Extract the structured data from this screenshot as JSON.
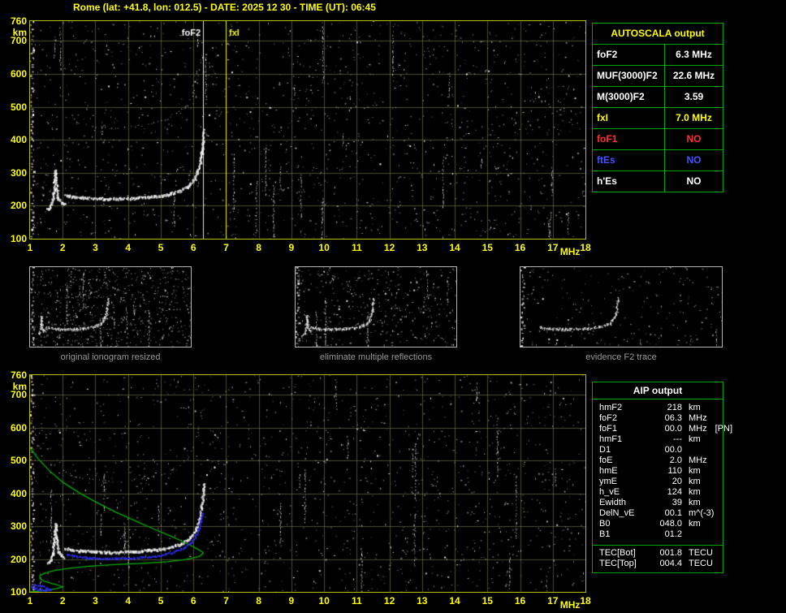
{
  "header": {
    "title": "Rome (lat: +41.8, lon: 012.5) - DATE: 2025 12 30 - TIME (UT): 06:45"
  },
  "autoscala_table": {
    "title": "AUTOSCALA output",
    "rows": [
      {
        "label": "foF2",
        "value": "6.3 MHz",
        "color": "#ffffff"
      },
      {
        "label": "MUF(3000)F2",
        "value": "22.6 MHz",
        "color": "#ffffff"
      },
      {
        "label": "M(3000)F2",
        "value": "3.59",
        "color": "#ffffff"
      },
      {
        "label": "fxI",
        "value": "7.0 MHz",
        "color": "#ffff00"
      },
      {
        "label": "foF1",
        "value": "NO",
        "color": "#ff3030"
      },
      {
        "label": "ftEs",
        "value": "NO",
        "color": "#4455ff"
      },
      {
        "label": "h'Es",
        "value": "NO",
        "color": "#ffffff"
      }
    ]
  },
  "aip_table": {
    "title": "AIP output",
    "rows": [
      {
        "label": "hmF2",
        "value": "218",
        "unit": "km",
        "extra": ""
      },
      {
        "label": "foF2",
        "value": "06.3",
        "unit": "MHz",
        "extra": ""
      },
      {
        "label": "foF1",
        "value": "00.0",
        "unit": "MHz",
        "extra": "[PN]"
      },
      {
        "label": "hmF1",
        "value": "---",
        "unit": "km",
        "extra": ""
      },
      {
        "label": "D1",
        "value": "00.0",
        "unit": "",
        "extra": ""
      },
      {
        "label": "foE",
        "value": "2.0",
        "unit": "MHz",
        "extra": ""
      },
      {
        "label": "hmE",
        "value": "110",
        "unit": "km",
        "extra": ""
      },
      {
        "label": "ymE",
        "value": "20",
        "unit": "km",
        "extra": ""
      },
      {
        "label": "h_vE",
        "value": "124",
        "unit": "km",
        "extra": ""
      },
      {
        "label": "Ewidth",
        "value": "39",
        "unit": "km",
        "extra": ""
      },
      {
        "label": "DelN_vE",
        "value": "00.1",
        "unit": "m^(-3)",
        "extra": ""
      },
      {
        "label": "B0",
        "value": "048.0",
        "unit": "km",
        "extra": ""
      },
      {
        "label": "B1",
        "value": "01.2",
        "unit": "",
        "extra": ""
      }
    ],
    "tec_rows": [
      {
        "label": "TEC[Bot]",
        "value": "001.8",
        "unit": "TECU"
      },
      {
        "label": "TEC[Top]",
        "value": "004.4",
        "unit": "TECU"
      }
    ]
  },
  "thumbnails": [
    {
      "caption": "original ionogram resized"
    },
    {
      "caption": "eliminate multiple reflections"
    },
    {
      "caption": "evidence F2 trace"
    }
  ],
  "colors": {
    "accent_yellow": "#ffff00",
    "table_green": "#00a800",
    "grid_olive": "rgba(150,150,95,0.5)",
    "trace_white": "#ffffff",
    "profile_green": "#00b000",
    "restored_blue": "#2b2bee",
    "caption_gray": "#9a9a9a",
    "foF1_red": "#ff3030",
    "ftEs_blue": "#4455ff"
  },
  "chart_data": [
    {
      "id": "ionogram-autoscala",
      "type": "scatter",
      "title": "ionogram with AUTOSCALA markers",
      "xlabel": "MHz",
      "ylabel": "km",
      "xlim": [
        1,
        18
      ],
      "ylim": [
        100,
        760
      ],
      "x_ticks": [
        1,
        2,
        3,
        4,
        5,
        6,
        7,
        8,
        9,
        10,
        11,
        12,
        13,
        14,
        15,
        16,
        17,
        18
      ],
      "y_ticks": [
        760,
        700,
        600,
        500,
        400,
        300,
        200,
        100
      ],
      "grid": true,
      "series": [
        {
          "name": "es-cusp",
          "render": "dots",
          "size": 2,
          "bold": true,
          "points": [
            [
              1.52,
              192
            ],
            [
              1.62,
              200
            ],
            [
              1.68,
              220
            ],
            [
              1.72,
              252
            ],
            [
              1.76,
              310
            ],
            [
              1.8,
              258
            ],
            [
              1.85,
              226
            ],
            [
              1.95,
              212
            ],
            [
              2.05,
              206
            ]
          ]
        },
        {
          "name": "f2-trace",
          "render": "dots",
          "size": 2,
          "bold": true,
          "points": [
            [
              2.05,
              236
            ],
            [
              2.3,
              230
            ],
            [
              2.6,
              227
            ],
            [
              3.0,
              225
            ],
            [
              3.4,
              224
            ],
            [
              3.8,
              224
            ],
            [
              4.2,
              226
            ],
            [
              4.6,
              229
            ],
            [
              5.0,
              233
            ],
            [
              5.3,
              239
            ],
            [
              5.6,
              249
            ],
            [
              5.85,
              263
            ],
            [
              6.0,
              281
            ],
            [
              6.1,
              302
            ],
            [
              6.18,
              328
            ],
            [
              6.24,
              362
            ],
            [
              6.28,
              400
            ],
            [
              6.3,
              432
            ]
          ]
        },
        {
          "name": "f2-second-hop",
          "render": "dots",
          "size": 1,
          "sparse": true,
          "points": [
            [
              2.0,
              470
            ],
            [
              2.4,
              452
            ],
            [
              2.9,
              442
            ],
            [
              3.4,
              437
            ],
            [
              3.9,
              438
            ],
            [
              4.4,
              444
            ],
            [
              4.8,
              452
            ],
            [
              5.2,
              464
            ],
            [
              5.5,
              480
            ],
            [
              5.8,
              505
            ],
            [
              6.0,
              540
            ],
            [
              6.1,
              575
            ],
            [
              6.18,
              615
            ],
            [
              6.24,
              655
            ]
          ]
        }
      ],
      "markers": [
        {
          "name": "foF2",
          "freq": 6.3,
          "color": "#ffffff",
          "label": "foF2",
          "label_side": "left"
        },
        {
          "name": "fxI",
          "freq": 7.0,
          "color": "#ffff00",
          "label": "fxI",
          "label_side": "right"
        }
      ]
    },
    {
      "id": "ionogram-aip",
      "type": "scatter",
      "title": "ionogram with AIP profile and restored trace",
      "xlabel": "MHz",
      "ylabel": "km",
      "xlim": [
        1,
        18
      ],
      "ylim": [
        100,
        760
      ],
      "x_ticks": [
        1,
        2,
        3,
        4,
        5,
        6,
        7,
        8,
        9,
        10,
        11,
        12,
        13,
        14,
        15,
        16,
        17,
        18
      ],
      "y_ticks": [
        760,
        700,
        600,
        500,
        400,
        300,
        200,
        100
      ],
      "grid": true,
      "series": [
        {
          "name": "es-cusp",
          "render": "dots",
          "size": 2,
          "bold": true,
          "points": [
            [
              1.52,
              192
            ],
            [
              1.62,
              200
            ],
            [
              1.68,
              220
            ],
            [
              1.72,
              252
            ],
            [
              1.76,
              310
            ],
            [
              1.8,
              258
            ],
            [
              1.85,
              226
            ],
            [
              1.95,
              212
            ],
            [
              2.05,
              206
            ]
          ]
        },
        {
          "name": "f2-trace",
          "render": "dots",
          "size": 2,
          "bold": true,
          "points": [
            [
              2.05,
              236
            ],
            [
              2.3,
              230
            ],
            [
              2.6,
              227
            ],
            [
              3.0,
              225
            ],
            [
              3.4,
              224
            ],
            [
              3.8,
              224
            ],
            [
              4.2,
              226
            ],
            [
              4.6,
              229
            ],
            [
              5.0,
              233
            ],
            [
              5.3,
              239
            ],
            [
              5.6,
              249
            ],
            [
              5.85,
              263
            ],
            [
              6.0,
              281
            ],
            [
              6.1,
              302
            ],
            [
              6.18,
              328
            ],
            [
              6.24,
              362
            ],
            [
              6.28,
              400
            ],
            [
              6.3,
              432
            ]
          ]
        },
        {
          "name": "f2-second-hop",
          "render": "dots",
          "size": 1,
          "sparse": true,
          "points": [
            [
              2.0,
              470
            ],
            [
              2.4,
              452
            ],
            [
              2.9,
              442
            ],
            [
              3.4,
              437
            ],
            [
              3.9,
              438
            ],
            [
              4.4,
              444
            ],
            [
              4.8,
              452
            ],
            [
              5.2,
              464
            ],
            [
              5.5,
              480
            ],
            [
              5.8,
              505
            ],
            [
              6.0,
              540
            ],
            [
              6.1,
              575
            ],
            [
              6.18,
              615
            ],
            [
              6.24,
              655
            ]
          ]
        },
        {
          "name": "ne-profile",
          "render": "line",
          "color": "#00b000",
          "points": [
            [
              0.95,
              545
            ],
            [
              1.25,
              505
            ],
            [
              1.6,
              468
            ],
            [
              2.0,
              434
            ],
            [
              2.5,
              402
            ],
            [
              3.0,
              374
            ],
            [
              3.6,
              344
            ],
            [
              4.2,
              317
            ],
            [
              4.8,
              291
            ],
            [
              5.4,
              266
            ],
            [
              5.8,
              247
            ],
            [
              6.1,
              232
            ],
            [
              6.28,
              221
            ],
            [
              6.3,
              218
            ],
            [
              6.18,
              208
            ],
            [
              5.8,
              199
            ],
            [
              5.2,
              192
            ],
            [
              4.4,
              187
            ],
            [
              3.6,
              183
            ],
            [
              2.8,
              178
            ],
            [
              2.2,
              172
            ],
            [
              1.75,
              165
            ],
            [
              1.45,
              157
            ],
            [
              1.3,
              149
            ],
            [
              1.3,
              141
            ],
            [
              1.42,
              133
            ],
            [
              1.62,
              127
            ],
            [
              1.85,
              121
            ],
            [
              2.0,
              115
            ],
            [
              1.82,
              110
            ],
            [
              1.55,
              106
            ],
            [
              1.25,
              102
            ],
            [
              1.0,
              100
            ]
          ]
        },
        {
          "name": "restored-trace",
          "render": "dots",
          "color": "#2b2bee",
          "size": 2,
          "points": [
            [
              2.1,
              216
            ],
            [
              2.4,
              209
            ],
            [
              2.8,
              205
            ],
            [
              3.2,
              203
            ],
            [
              3.6,
              203
            ],
            [
              4.0,
              204
            ],
            [
              4.4,
              206
            ],
            [
              4.8,
              210
            ],
            [
              5.1,
              215
            ],
            [
              5.4,
              223
            ],
            [
              5.7,
              236
            ],
            [
              5.9,
              251
            ],
            [
              6.05,
              271
            ],
            [
              6.15,
              293
            ],
            [
              6.22,
              316
            ],
            [
              6.27,
              342
            ]
          ]
        },
        {
          "name": "e-region-echo",
          "render": "dots",
          "color": "#2b2bee",
          "size": 2,
          "points": [
            [
              1.0,
              118
            ],
            [
              1.15,
              112
            ],
            [
              1.3,
              108
            ],
            [
              1.45,
              106
            ],
            [
              1.6,
              108
            ],
            [
              1.5,
              114
            ],
            [
              1.3,
              120
            ],
            [
              1.1,
              124
            ]
          ]
        }
      ],
      "markers": []
    }
  ]
}
